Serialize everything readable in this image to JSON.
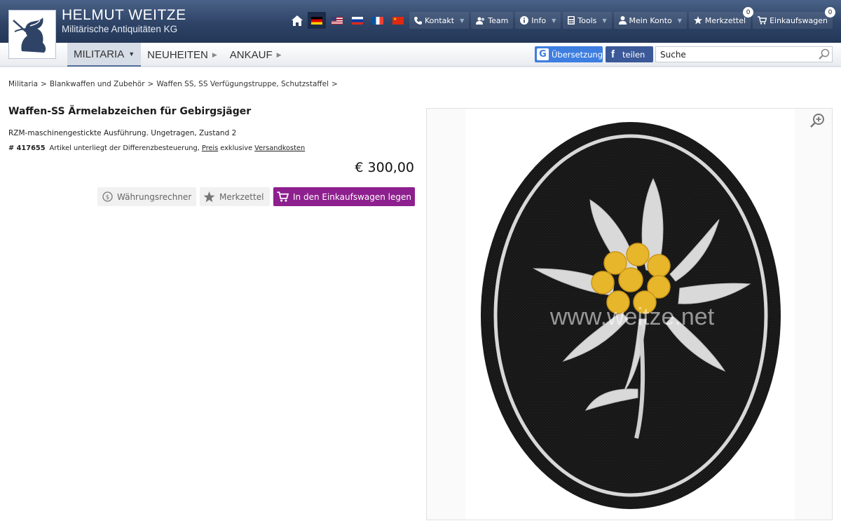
{
  "brand": {
    "name": "HELMUT WEITZE",
    "subtitle": "Militärische Antiquitäten KG"
  },
  "topnav": {
    "flags": [
      "de",
      "us",
      "ru",
      "fr",
      "cn"
    ],
    "items": [
      {
        "label": "Kontakt",
        "icon": "phone-icon"
      },
      {
        "label": "Team",
        "icon": "team-icon"
      },
      {
        "label": "Info",
        "icon": "info-icon"
      },
      {
        "label": "Tools",
        "icon": "calculator-icon"
      },
      {
        "label": "Mein Konto",
        "icon": "user-icon"
      },
      {
        "label": "Merkzettel",
        "icon": "star-icon",
        "badge": "0"
      },
      {
        "label": "Einkaufswagen",
        "icon": "cart-icon",
        "badge": "0"
      }
    ]
  },
  "mainnav": {
    "militaria": "MILITARIA",
    "neuheiten": "NEUHEITEN",
    "ankauf": "ANKAUF"
  },
  "translate_label": "Übersetzung",
  "share_label": "teilen",
  "search": {
    "value": "Suche"
  },
  "breadcrumb": [
    "Militaria",
    ">",
    "Blankwaffen und Zubehör",
    ">",
    "Waffen SS, SS Verfügungstruppe, Schutzstaffel",
    ">"
  ],
  "product": {
    "title": "Waffen-SS Ärmelabzeichen für Gebirgsjäger",
    "description": "RZM-maschinengestickte Ausführung. Ungetragen, Zustand 2",
    "article_number": "# 417655",
    "tax_note": "Artikel unterliegt der Differenzbesteuerung,",
    "price_link": "Preis",
    "exclusive": "exklusive",
    "shipping_link": "Versandkosten",
    "price": "€ 300,00"
  },
  "actions": {
    "currency": "Währungsrechner",
    "wishlist": "Merkzettel",
    "add_to_cart": "In den Einkaufswagen legen"
  },
  "image_watermark": "www.weitze.net",
  "colors": {
    "header": "#2e4366",
    "cart_button": "#8e1f8e",
    "google": "#3d7ee0",
    "facebook": "#3b5998"
  }
}
